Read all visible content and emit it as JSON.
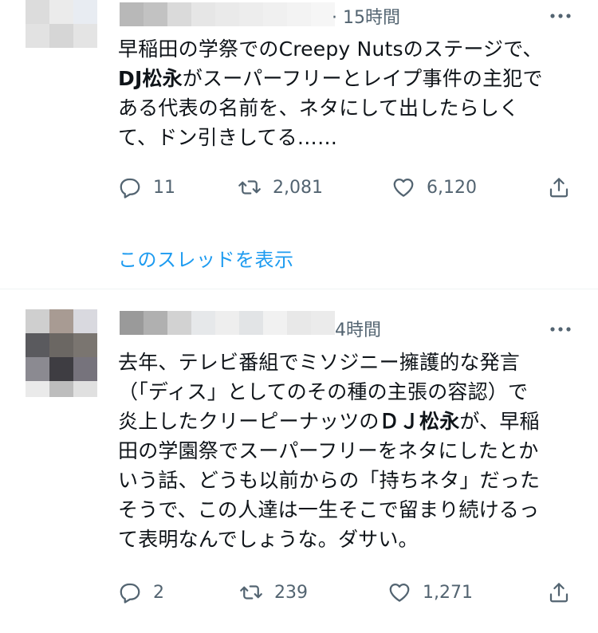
{
  "tweets": [
    {
      "time": "15時間",
      "text_lines": [
        "早稲田の学祭でのCreepy Nutsのステージで、",
        [
          "DJ松永",
          "がスーパーフリーとレイプ事件の主犯で"
        ],
        "ある代表の名前を、ネタにして出したらしく",
        "て、ドン引きしてる……"
      ],
      "replies": "11",
      "retweets": "2,081",
      "likes": "6,120"
    },
    {
      "time": "4時間",
      "text_lines": [
        "去年、テレビ番組でミソジニー擁護的な発言",
        "（「ディス」としてのその種の主張の容認）で",
        [
          "炎上したクリーピーナッツの",
          "ＤＪ松永",
          "が、早稲"
        ],
        "田の学園祭でスーパーフリーをネタにしたとか",
        "いう話、どうも以前からの「持ちネタ」だった",
        "そうで、この人達は一生そこで留まり続けるっ",
        "て表明なんでしょうな。ダサい。"
      ],
      "replies": "2",
      "retweets": "239",
      "likes": "1,271"
    }
  ],
  "thread_link": "このスレッドを表示",
  "icons": [
    "reply-icon",
    "retweet-icon",
    "like-icon",
    "share-icon",
    "more-icon"
  ],
  "colors": {
    "link": "#1d9bf0",
    "muted": "#536471",
    "text": "#0f1419"
  }
}
